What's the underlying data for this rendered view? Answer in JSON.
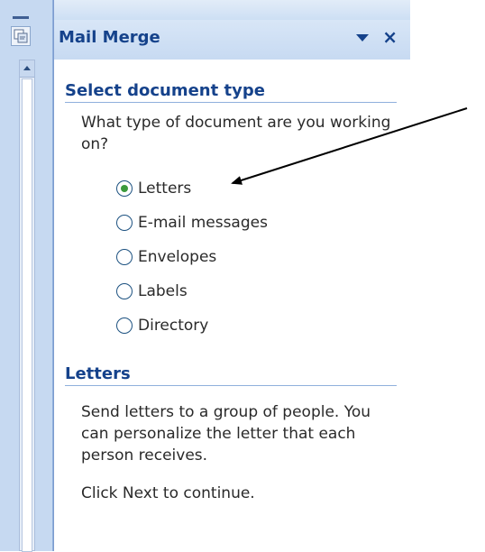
{
  "pane": {
    "title": "Mail Merge",
    "dropdown_icon": "chevron-down-icon",
    "close_label": "×"
  },
  "doc_type": {
    "heading": "Select document type",
    "prompt": "What type of document are you working on?",
    "options": [
      {
        "label": "Letters",
        "checked": true
      },
      {
        "label": "E-mail messages",
        "checked": false
      },
      {
        "label": "Envelopes",
        "checked": false
      },
      {
        "label": "Labels",
        "checked": false
      },
      {
        "label": "Directory",
        "checked": false
      }
    ]
  },
  "letters": {
    "heading": "Letters",
    "description": "Send letters to a group of people. You can personalize the letter that each person receives.",
    "next": "Click Next to continue."
  },
  "colors": {
    "accent": "#15428b",
    "header_bg": "#c7daf2",
    "radio_dot": "#3c9a3c"
  }
}
